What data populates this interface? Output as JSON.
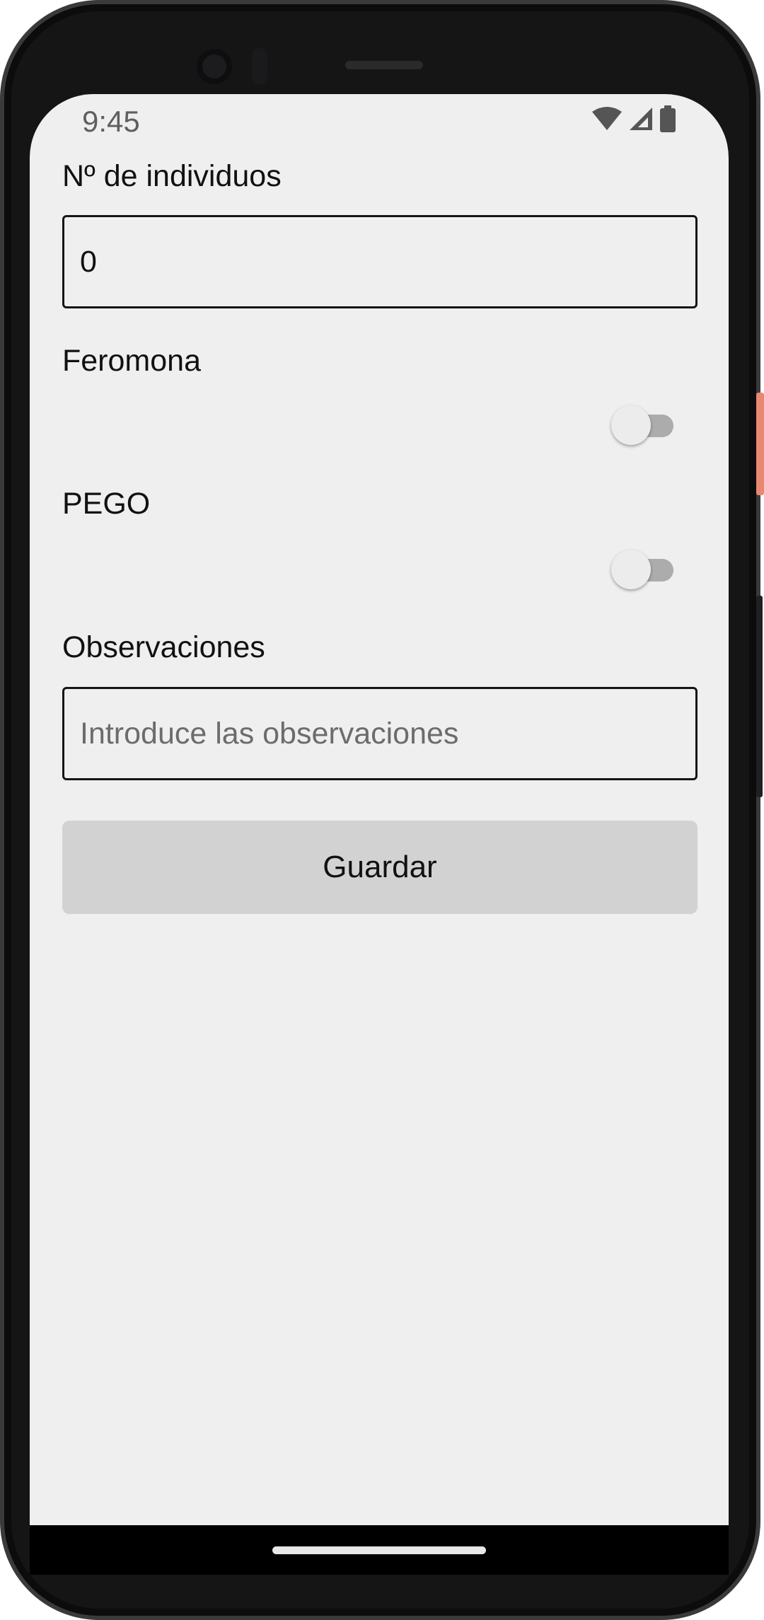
{
  "status_bar": {
    "time": "9:45",
    "icons": [
      "wifi-icon",
      "cellular-signal-icon",
      "battery-icon"
    ]
  },
  "form": {
    "individuals": {
      "label": "Nº de individuos",
      "value": "0"
    },
    "pheromone": {
      "label": "Feromona",
      "checked": false
    },
    "pego": {
      "label": "PEGO",
      "checked": false
    },
    "observations": {
      "label": "Observaciones",
      "value": "",
      "placeholder": "Introduce las observaciones"
    },
    "save_label": "Guardar"
  },
  "colors": {
    "screen_background": "#efefef",
    "button_background": "#d3d2d3",
    "switch_track_off": "#acacac",
    "switch_thumb_off": "#ececec",
    "text": "#111111"
  }
}
